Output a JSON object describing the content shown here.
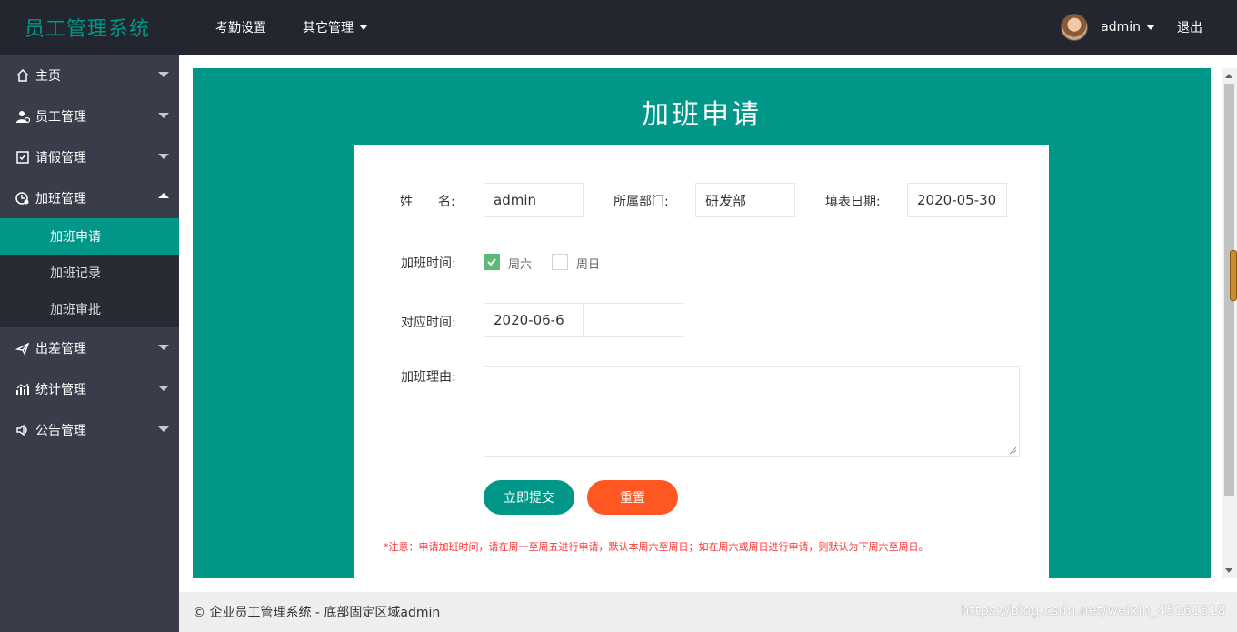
{
  "header": {
    "logo": "员工管理系统",
    "nav": [
      {
        "label": "考勤设置"
      },
      {
        "label": "其它管理"
      }
    ],
    "user": "admin",
    "logout": "退出"
  },
  "sidebar": {
    "items": [
      {
        "label": "主页",
        "icon": "home-icon"
      },
      {
        "label": "员工管理",
        "icon": "user-icon"
      },
      {
        "label": "请假管理",
        "icon": "leave-icon"
      },
      {
        "label": "加班管理",
        "icon": "overtime-icon"
      },
      {
        "label": "出差管理",
        "icon": "plane-icon"
      },
      {
        "label": "统计管理",
        "icon": "chart-icon"
      },
      {
        "label": "公告管理",
        "icon": "speaker-icon"
      }
    ],
    "sub_items": [
      {
        "label": "加班申请",
        "active": true
      },
      {
        "label": "加班记录"
      },
      {
        "label": "加班审批"
      }
    ]
  },
  "form": {
    "title": "加班申请",
    "name_label": "姓　　名:",
    "name_value": "admin",
    "dept_label": "所属部门:",
    "dept_value": "研发部",
    "date_label": "填表日期:",
    "date_value": "2020-05-30",
    "time_label": "加班时间:",
    "saturday": "周六",
    "saturday_checked": true,
    "sunday": "周日",
    "sunday_checked": false,
    "corr_label": "对应时间:",
    "corr_value": "2020-06-6",
    "corr_value2": "",
    "reason_label": "加班理由:",
    "reason_value": "",
    "submit": "立即提交",
    "reset": "重置",
    "note": "*注意：申请加班时间，请在周一至周五进行申请，默认本周六至周日；如在周六或周日进行申请，则默认为下周六至周日。"
  },
  "footer": {
    "text": "© 企业员工管理系统 - 底部固定区域admin",
    "watermark": "https://blog.csdn.net/weixin_45161518"
  },
  "colors": {
    "accent": "#009688",
    "header_bg": "#23262e",
    "sidebar_bg": "#393d49",
    "reset_button": "#ff5722",
    "checkbox_checked": "#5fb878",
    "note_text": "#ff3333"
  }
}
